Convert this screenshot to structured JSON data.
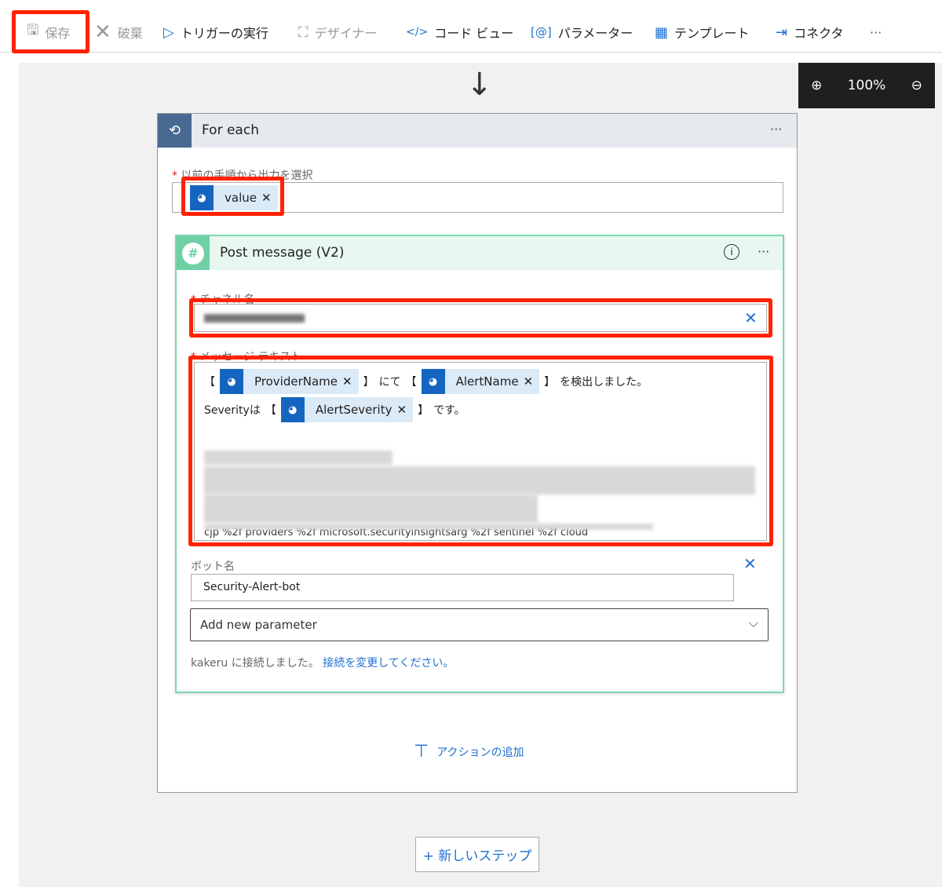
{
  "toolbar": {
    "save": "保存",
    "discard": "破棄",
    "run_trigger": "トリガーの実行",
    "designer": "デザイナー",
    "code_view": "コード ビュー",
    "parameters": "パラメーター",
    "templates": "テンプレート",
    "connectors": "コネクタ",
    "more": "···"
  },
  "zoom": {
    "level": "100%"
  },
  "foreach": {
    "title": "For each",
    "more": "···",
    "select_label": "以前の手順から出力を選択",
    "token": "value"
  },
  "post": {
    "title": "Post message (V2)",
    "more": "···",
    "channel_label": "チャネル名",
    "message_label": "メッセージ テキスト",
    "msg": {
      "b_open": "【",
      "b_close": "】",
      "niteru": "にて",
      "detected": "を検出しました。",
      "severity_prefix": "Severityは",
      "desu": "です。",
      "token1": "ProviderName",
      "token2": "AlertName",
      "token3": "AlertSeverity",
      "url_fragment": "cjp %2f providers %2f microsoft.securityinsightsarg %2f sentinel %2f cloud"
    },
    "bot_label": "ボット名",
    "bot_value": "Security-Alert-bot",
    "add_param": "Add new parameter",
    "connected": "kakeru に接続しました。",
    "change_conn": "接続を変更してください。"
  },
  "add_action": "アクションの追加",
  "new_step": "+ 新しいステップ",
  "colors": {
    "accent": "#0f6cbd",
    "highlight": "#ff2200",
    "slack_green": "#6fcfa5",
    "loop_blue": "#486991"
  }
}
